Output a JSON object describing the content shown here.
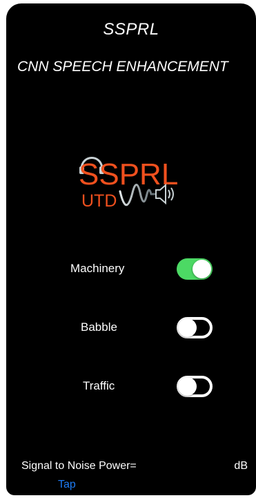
{
  "app": {
    "title": "SSPRL",
    "subtitle": "CNN SPEECH ENHANCEMENT"
  },
  "logo": {
    "main_text": "SSPRL",
    "sub_text": "UTD",
    "colors": {
      "main": "#f0501e",
      "wave": "#a9b4b8",
      "headphones": "#c7d0d3"
    }
  },
  "noise_types": [
    {
      "label": "Machinery",
      "enabled": true
    },
    {
      "label": "Babble",
      "enabled": false
    },
    {
      "label": "Traffic",
      "enabled": false
    }
  ],
  "snr": {
    "label": "Signal to Noise Power=",
    "unit": "dB"
  },
  "tap_button": {
    "label": "Tap"
  },
  "colors": {
    "toggle_on": "#4cd964",
    "link": "#1e7cf5",
    "background": "#000000"
  }
}
